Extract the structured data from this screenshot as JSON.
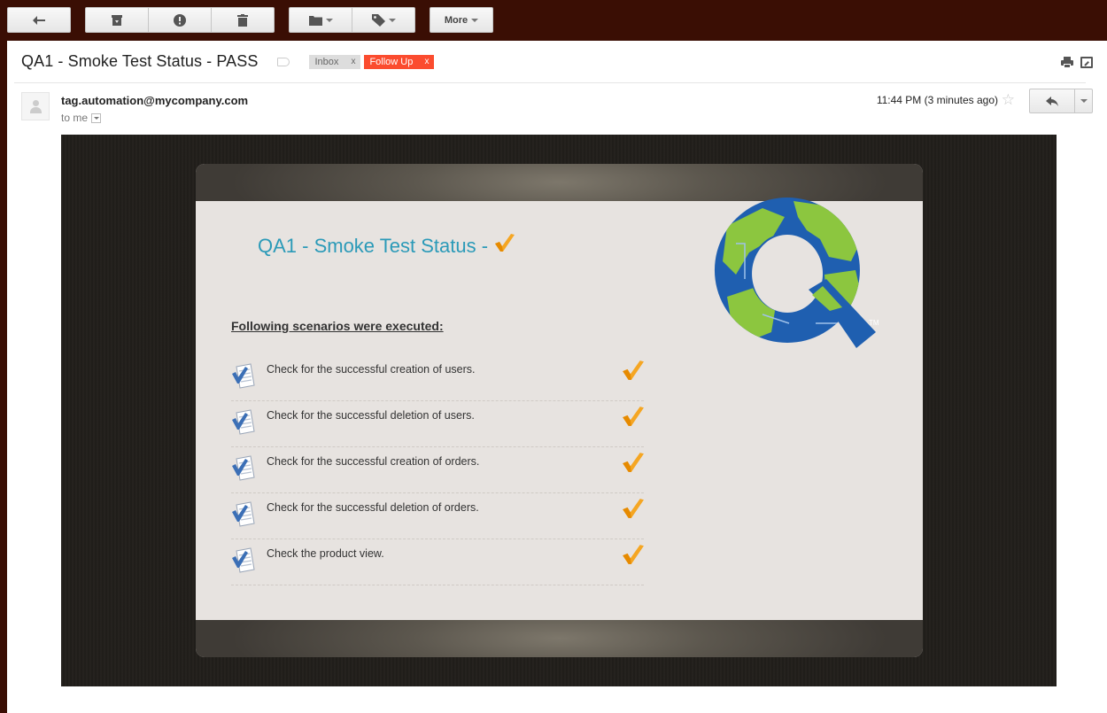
{
  "toolbar": {
    "more_label": "More"
  },
  "email": {
    "subject": "QA1 - Smoke Test Status - PASS",
    "labels": [
      {
        "name": "Inbox",
        "close": "x"
      },
      {
        "name": "Follow Up",
        "close": "x"
      }
    ],
    "sender": "tag.automation@mycompany.com",
    "recipient": "to me",
    "time": "11:44 PM (3 minutes ago)"
  },
  "body": {
    "title": "QA1 - Smoke Test Status -",
    "section_heading": "Following scenarios were executed:",
    "scenarios": [
      "Check for the successful creation of users.",
      "Check for the successful deletion of users.",
      "Check for the successful creation of orders.",
      "Check for the successful deletion of orders.",
      "Check the product view."
    ],
    "logo_trademark": "TM"
  },
  "colors": {
    "title": "#2b9ab8",
    "follow_up_label": "#fb4c2f",
    "checkmark": "#f39c12",
    "frame": "#3a0e04"
  }
}
